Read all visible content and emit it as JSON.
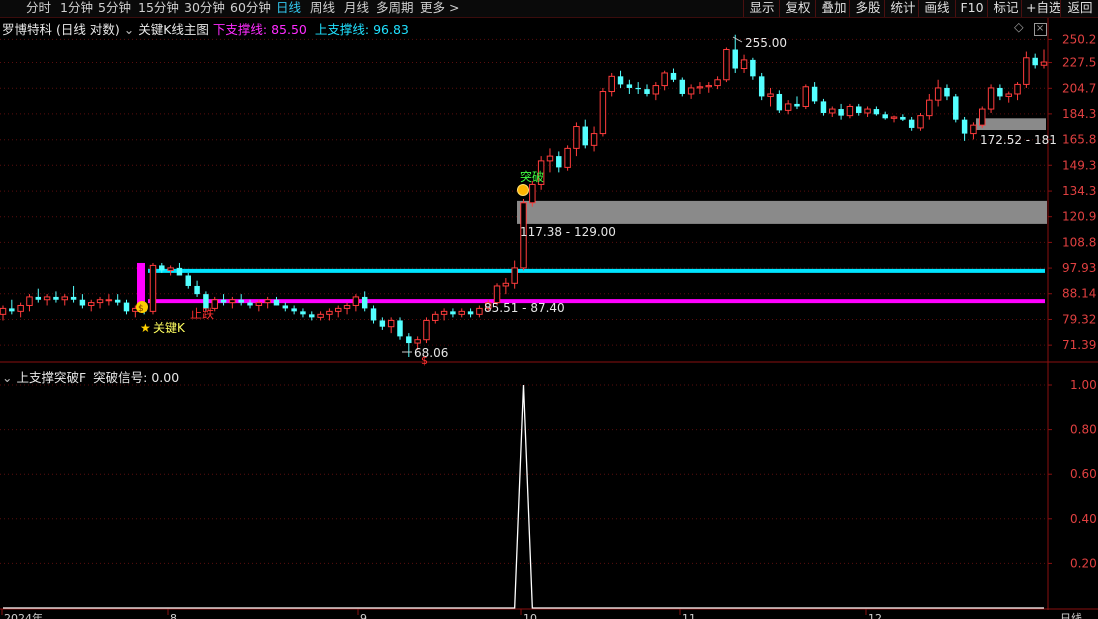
{
  "toolbar": {
    "periods": [
      {
        "label": "分时",
        "active": false
      },
      {
        "label": "1分钟",
        "active": false
      },
      {
        "label": "5分钟",
        "active": false
      },
      {
        "label": "15分钟",
        "active": false
      },
      {
        "label": "30分钟",
        "active": false
      },
      {
        "label": "60分钟",
        "active": false
      },
      {
        "label": "日线",
        "active": true
      },
      {
        "label": "周线",
        "active": false
      },
      {
        "label": "月线",
        "active": false
      },
      {
        "label": "多周期",
        "active": false
      },
      {
        "label": "更多 >",
        "active": false
      }
    ],
    "right_buttons": [
      "显示",
      "复权",
      "叠加",
      "多股",
      "统计",
      "画线",
      "F10",
      "标记",
      "+自选",
      "返回"
    ]
  },
  "main_panel": {
    "stock_name": "罗博特科",
    "period_mode": "(日线 对数)",
    "indicator_name": "关键K线主图",
    "lower_support_label": "下支撑线:",
    "lower_support_value": "85.50",
    "upper_support_label": "上支撑线:",
    "upper_support_value": "96.83",
    "price_axis": [
      "250.2",
      "227.5",
      "204.7",
      "184.3",
      "165.8",
      "149.3",
      "134.3",
      "120.9",
      "108.8",
      "97.93",
      "88.14",
      "79.32",
      "71.39"
    ],
    "annotations": {
      "high": "255.00",
      "low": "68.06",
      "breakthrough": "突破",
      "key_k": "关键K",
      "stop_fall": "止跌",
      "zone_high": "117.38 - 129.00",
      "zone_low": "85.51 - 87.40",
      "zone_right": "172.52 - 181"
    },
    "colors": {
      "up": "#ff3c3c",
      "down": "#54ffff",
      "lower_line": "#ff00ff",
      "upper_line": "#00e5ff",
      "zone": "#8a8a8a"
    }
  },
  "sub_panel": {
    "title": "上支撑突破F",
    "signal_label": "突破信号:",
    "signal_value": "0.00",
    "axis": [
      "1.00",
      "0.80",
      "0.60",
      "0.40",
      "0.20"
    ]
  },
  "date_axis": {
    "labels": [
      "2024年",
      "8",
      "9",
      "10",
      "11",
      "12"
    ],
    "period_label": "日线"
  },
  "chart_data": {
    "type": "candlestick",
    "title": "罗博特科 (日线 对数)",
    "y_scale": "log",
    "ylim": [
      68,
      260
    ],
    "series": [
      {
        "name": "下支撑线",
        "value": 85.5
      },
      {
        "name": "上支撑线",
        "value": 96.83
      }
    ],
    "price_high": 255.0,
    "price_low": 68.06,
    "zones": [
      {
        "label": "117.38 - 129.00",
        "low": 117.38,
        "high": 129.0
      },
      {
        "label": "85.51 - 87.40",
        "low": 85.51,
        "high": 87.4
      },
      {
        "label": "172.52 - 181",
        "low": 172.52,
        "high": 181
      }
    ],
    "ohlc": [
      [
        81,
        84,
        79,
        83
      ],
      [
        83,
        86,
        81,
        82
      ],
      [
        82,
        85,
        80,
        84
      ],
      [
        84,
        88,
        82,
        87
      ],
      [
        87,
        90,
        85,
        86
      ],
      [
        86,
        88,
        84,
        87
      ],
      [
        87,
        89,
        85,
        86
      ],
      [
        86,
        88,
        84,
        87
      ],
      [
        87,
        91,
        85,
        86
      ],
      [
        86,
        88,
        83,
        84
      ],
      [
        84,
        86,
        82,
        85
      ],
      [
        85,
        87,
        83,
        86
      ],
      [
        86,
        88,
        84,
        86
      ],
      [
        86,
        88,
        84,
        85
      ],
      [
        85,
        86,
        81,
        82
      ],
      [
        82,
        84,
        80,
        83
      ],
      [
        83,
        85,
        81,
        82
      ],
      [
        82,
        100,
        81,
        99
      ],
      [
        99,
        100,
        96,
        97
      ],
      [
        97,
        99,
        95,
        98
      ],
      [
        98,
        100,
        96,
        95
      ],
      [
        95,
        96,
        90,
        91
      ],
      [
        91,
        93,
        87,
        88
      ],
      [
        88,
        89,
        82,
        83
      ],
      [
        83,
        87,
        82,
        86
      ],
      [
        86,
        88,
        84,
        85
      ],
      [
        85,
        87,
        83,
        86
      ],
      [
        86,
        88,
        84,
        85
      ],
      [
        85,
        86,
        83,
        84
      ],
      [
        84,
        86,
        82,
        85
      ],
      [
        85,
        87,
        83,
        86
      ],
      [
        86,
        87,
        84,
        84
      ],
      [
        84,
        85,
        82,
        83
      ],
      [
        83,
        84,
        81,
        82
      ],
      [
        82,
        83,
        80,
        81
      ],
      [
        81,
        82,
        79,
        80
      ],
      [
        80,
        82,
        79,
        81
      ],
      [
        81,
        83,
        79,
        82
      ],
      [
        82,
        84,
        80,
        83
      ],
      [
        83,
        85,
        81,
        84
      ],
      [
        84,
        88,
        82,
        87
      ],
      [
        87,
        89,
        82,
        83
      ],
      [
        83,
        84,
        78,
        79
      ],
      [
        79,
        80,
        76,
        77
      ],
      [
        77,
        80,
        75,
        79
      ],
      [
        79,
        80,
        73,
        74
      ],
      [
        74,
        75,
        68,
        72
      ],
      [
        72,
        74,
        70,
        73
      ],
      [
        73,
        80,
        72,
        79
      ],
      [
        79,
        82,
        78,
        81
      ],
      [
        81,
        83,
        79,
        82
      ],
      [
        82,
        83,
        80,
        81
      ],
      [
        81,
        83,
        80,
        82
      ],
      [
        82,
        83,
        80,
        81
      ],
      [
        81,
        84,
        80,
        83
      ],
      [
        83,
        86,
        82,
        85
      ],
      [
        85,
        92,
        84,
        91
      ],
      [
        91,
        94,
        88,
        92
      ],
      [
        92,
        101,
        90,
        98
      ],
      [
        98,
        130,
        97,
        128
      ],
      [
        128,
        140,
        126,
        138
      ],
      [
        138,
        155,
        135,
        152
      ],
      [
        152,
        160,
        145,
        155
      ],
      [
        155,
        158,
        145,
        148
      ],
      [
        148,
        162,
        146,
        160
      ],
      [
        160,
        178,
        155,
        175
      ],
      [
        175,
        180,
        160,
        162
      ],
      [
        162,
        175,
        158,
        170
      ],
      [
        170,
        205,
        168,
        202
      ],
      [
        202,
        218,
        198,
        215
      ],
      [
        215,
        220,
        205,
        208
      ],
      [
        208,
        212,
        200,
        205
      ],
      [
        205,
        210,
        200,
        204
      ],
      [
        204,
        208,
        198,
        200
      ],
      [
        200,
        210,
        195,
        207
      ],
      [
        207,
        220,
        203,
        218
      ],
      [
        218,
        222,
        210,
        212
      ],
      [
        212,
        214,
        198,
        200
      ],
      [
        200,
        208,
        196,
        205
      ],
      [
        205,
        210,
        200,
        206
      ],
      [
        206,
        210,
        201,
        207
      ],
      [
        207,
        215,
        204,
        212
      ],
      [
        212,
        242,
        210,
        240
      ],
      [
        240,
        255,
        218,
        222
      ],
      [
        222,
        235,
        218,
        230
      ],
      [
        230,
        232,
        212,
        215
      ],
      [
        215,
        218,
        195,
        198
      ],
      [
        198,
        205,
        190,
        200
      ],
      [
        200,
        203,
        185,
        187
      ],
      [
        187,
        195,
        184,
        192
      ],
      [
        192,
        198,
        188,
        190
      ],
      [
        190,
        208,
        188,
        206
      ],
      [
        206,
        210,
        192,
        194
      ],
      [
        194,
        196,
        183,
        185
      ],
      [
        185,
        190,
        182,
        188
      ],
      [
        188,
        192,
        180,
        183
      ],
      [
        183,
        192,
        181,
        190
      ],
      [
        190,
        192,
        183,
        185
      ],
      [
        185,
        190,
        182,
        188
      ],
      [
        188,
        190,
        183,
        184
      ],
      [
        184,
        186,
        180,
        181
      ],
      [
        181,
        183,
        178,
        182
      ],
      [
        182,
        184,
        179,
        180
      ],
      [
        180,
        182,
        172,
        174
      ],
      [
        174,
        185,
        172,
        183
      ],
      [
        183,
        200,
        180,
        195
      ],
      [
        195,
        212,
        190,
        205
      ],
      [
        205,
        208,
        195,
        198
      ],
      [
        198,
        200,
        178,
        180
      ],
      [
        180,
        182,
        165,
        170
      ],
      [
        170,
        178,
        166,
        176
      ],
      [
        176,
        190,
        174,
        188
      ],
      [
        188,
        208,
        185,
        205
      ],
      [
        205,
        208,
        195,
        198
      ],
      [
        198,
        202,
        193,
        200
      ],
      [
        200,
        210,
        195,
        208
      ],
      [
        208,
        238,
        205,
        232
      ],
      [
        232,
        236,
        222,
        225
      ],
      [
        225,
        240,
        222,
        228
      ]
    ],
    "signal": {
      "type": "line",
      "ylim": [
        0,
        1.05
      ],
      "peak_index": 59,
      "peak_value": 1.0
    }
  }
}
